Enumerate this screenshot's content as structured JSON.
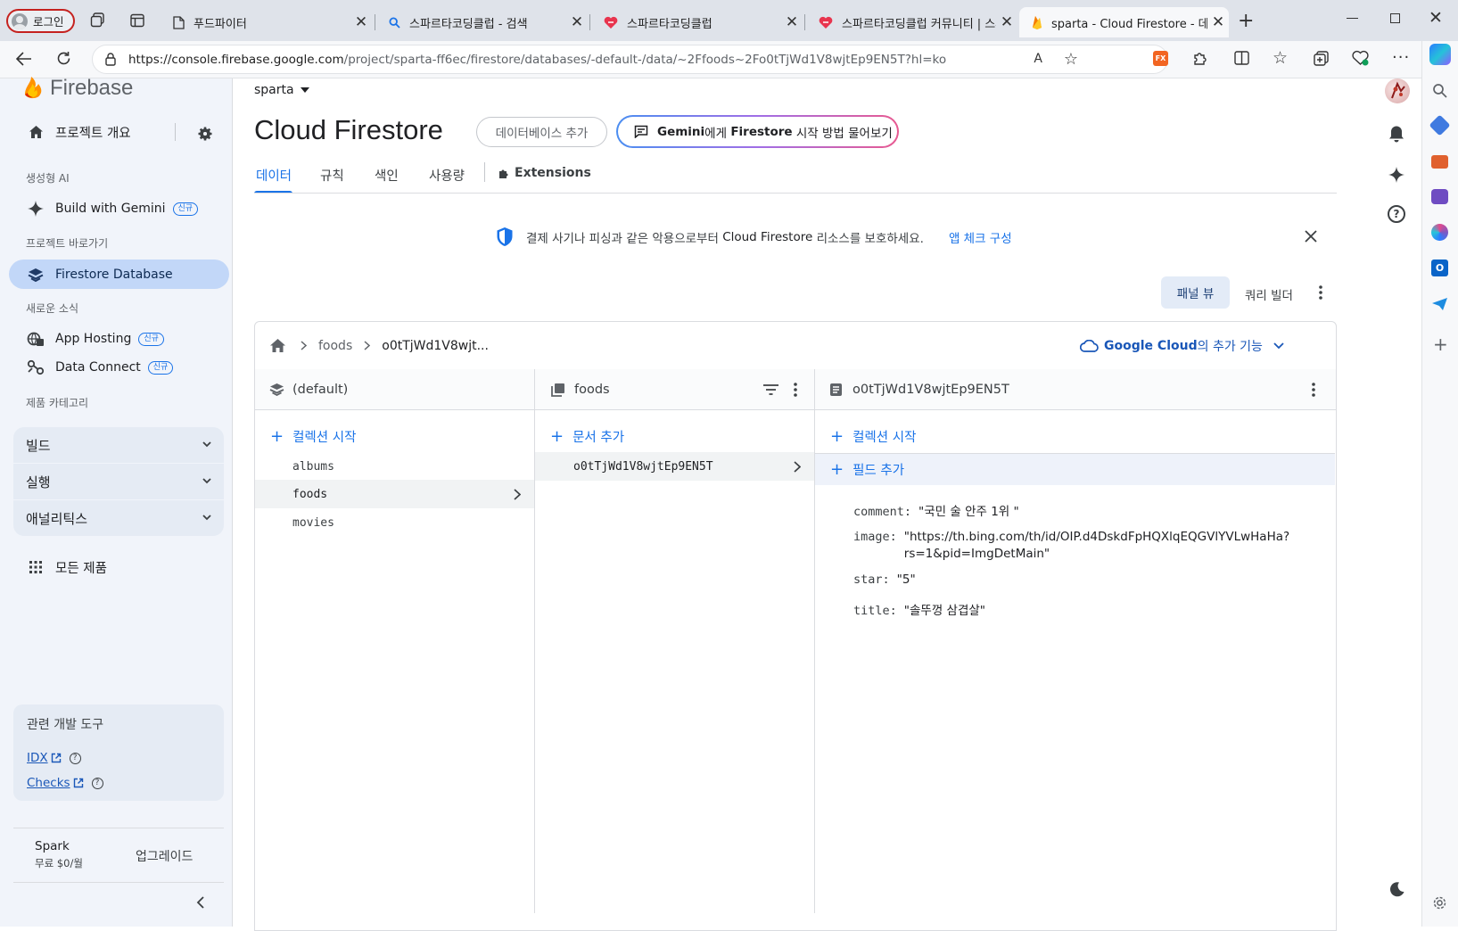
{
  "browser": {
    "profile_label": "로그인",
    "tabs": [
      {
        "title": "푸드파이터"
      },
      {
        "title": "스파르타코딩클럽 - 검색"
      },
      {
        "title": "스파르타코딩클럽"
      },
      {
        "title": "스파르타코딩클럽 커뮤니티 | 스파"
      },
      {
        "title": "sparta - Cloud Firestore - 데이터"
      }
    ],
    "url": "https://console.firebase.google.com/project/sparta-ff6ec/firestore/databases/-default-/data/~2Ffoods~2Fo0tTjWd1V8wjtEp9EN5T?hl=ko",
    "url_host": "https://console.firebase.google.com",
    "url_path": "/project/sparta-ff6ec/firestore/databases/-default-/data/~2Ffoods~2Fo0tTjWd1V8wjtEp9EN5T?hl=ko"
  },
  "sidebar": {
    "brand": "Firebase",
    "overview_label": "프로젝트 개요",
    "genai_section": "생성형 AI",
    "build_with_gemini": "Build with Gemini",
    "new_badge": "신규",
    "shortcuts_section": "프로젝트 바로가기",
    "firestore_db": "Firestore Database",
    "news_section": "새로운 소식",
    "app_hosting": "App Hosting",
    "data_connect": "Data Connect",
    "categories_section": "제품 카테고리",
    "accordions": [
      "빌드",
      "실행",
      "애널리틱스"
    ],
    "all_products": "모든 제품",
    "devtools_title": "관련 개발 도구",
    "devtools_links": [
      "IDX",
      "Checks"
    ],
    "plan_name": "Spark",
    "plan_price": "무료 $0/월",
    "upgrade": "업그레이드"
  },
  "main": {
    "project_name": "sparta",
    "page_title": "Cloud Firestore",
    "add_db_button": "데이터베이스 추가",
    "gemini_button_bold": "Gemini",
    "gemini_button_text_a": "에게 ",
    "gemini_button_bold2": "Firestore",
    "gemini_button_text_b": " 시작 방법 물어보기",
    "tabs": [
      "데이터",
      "규칙",
      "색인",
      "사용량",
      "Extensions"
    ],
    "banner_text_a": "결제 사기나 피싱과 같은 악용으로부터 ",
    "banner_text_bold": "Cloud Firestore",
    "banner_text_b": " 리소스를 보호하세요.",
    "banner_link": "앱 체크 구성",
    "view_panel": "패널 뷰",
    "view_query": "쿼리 빌더",
    "breadcrumb": [
      "foods",
      "o0tTjWd1V8wjt..."
    ],
    "gcloud_link_bold": "Google Cloud",
    "gcloud_link_rest": "의 추가 기능",
    "col1": {
      "title": "(default)",
      "action": "컬렉션 시작",
      "items": [
        "albums",
        "foods",
        "movies"
      ]
    },
    "col2": {
      "title": "foods",
      "action": "문서 추가",
      "items": [
        "o0tTjWd1V8wjtEp9EN5T"
      ]
    },
    "col3": {
      "title": "o0tTjWd1V8wjtEp9EN5T",
      "action_collection": "컬렉션 시작",
      "action_field": "필드 추가",
      "fields": [
        {
          "key": "comment:",
          "value": "\"국민 술 안주 1위 \""
        },
        {
          "key": "image:",
          "value": "\"https://th.bing.com/th/id/OIP.d4DskdFpHQXlqEQGVlYVLwHaHa?",
          "value2": "rs=1&pid=ImgDetMain\""
        },
        {
          "key": "star:",
          "value": "\"5\""
        },
        {
          "key": "title:",
          "value": "\"솔뚜껑 삼겹살\""
        }
      ]
    }
  },
  "colors": {
    "accent": "#1a73e8",
    "active_nav": "#c2d7f8",
    "sidebar_bg": "#f1f4fa"
  }
}
